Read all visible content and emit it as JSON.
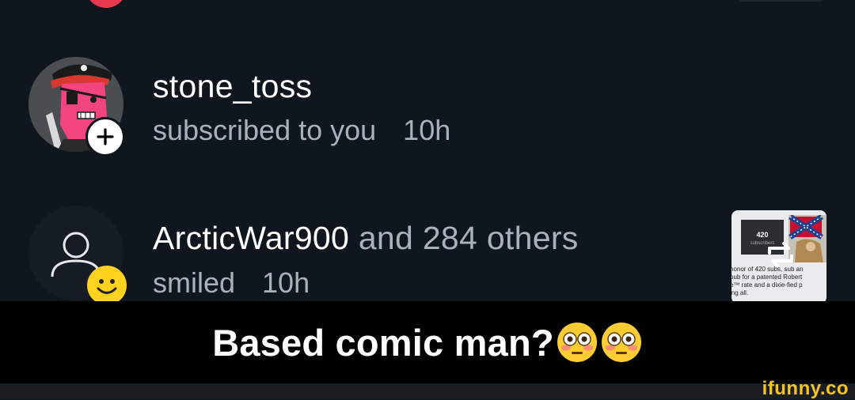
{
  "notifications": [
    {
      "username": "stone_toss",
      "others": "",
      "action": "subscribed to you",
      "time": "10h",
      "badge_icon": "plus-icon",
      "avatar": "pirate-avatar"
    },
    {
      "username": "ArcticWar900",
      "others": " and 284 others",
      "action": "smiled",
      "time": "10h",
      "badge_icon": "smile-icon",
      "avatar": "default-user-avatar",
      "thumbnail": {
        "subs_count": "420",
        "subs_label": "subscribers",
        "text_lines": [
          "honor of 420 subs, sub an",
          "pub for a patented Robert",
          "e™ rate and a dixie-fied p",
          "ing all."
        ]
      }
    }
  ],
  "caption": {
    "text": "Based comic man?",
    "emojis": [
      "flushed-face-emoji",
      "flushed-face-emoji"
    ]
  },
  "watermark": "ifunny.co",
  "colors": {
    "background": "#10161d",
    "primary_text": "#ffffff",
    "secondary_text": "#a9b1ba",
    "badge_yellow": "#ffd21f",
    "watermark_yellow": "#f6c41c"
  }
}
